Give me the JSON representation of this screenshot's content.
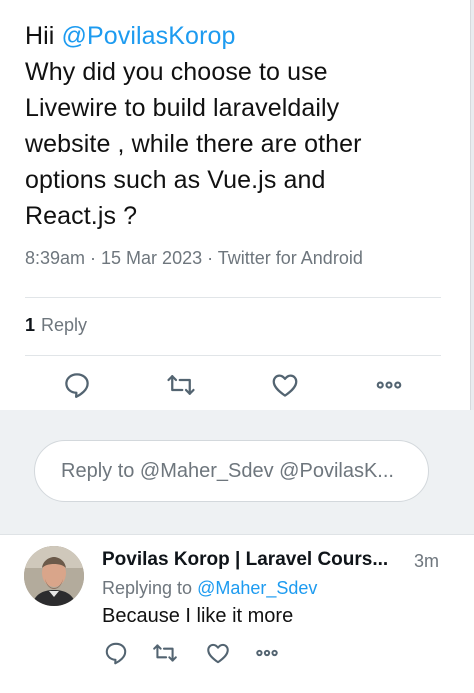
{
  "tweet": {
    "text_lines": [
      {
        "prefix": "Hii ",
        "mention": "@PovilasKorop"
      },
      "Why did you choose to use",
      "Livewire to build laraveldaily",
      "website , while there are other",
      "options such as Vue.js and",
      "React.js ?"
    ],
    "meta": "8:39am · 15 Mar 2023 · Twitter for Android",
    "reply_count": "1",
    "reply_label": "Reply",
    "actions": [
      "reply-icon",
      "retweet-icon",
      "like-icon",
      "more-icon"
    ]
  },
  "reply_box": {
    "placeholder": "Reply to @Maher_Sdev @PovilasK..."
  },
  "reply_tweet": {
    "author": "Povilas Korop | Laravel Cours...",
    "time": "3m",
    "replying_to_label": "Replying to",
    "replying_to_handle": "@Maher_Sdev",
    "text": "Because I like it more",
    "actions": [
      "reply-icon",
      "retweet-icon",
      "like-icon",
      "more-icon"
    ]
  },
  "colors": {
    "accent": "#1d9bf0",
    "muted": "#6e767d",
    "text": "#0f1419"
  }
}
